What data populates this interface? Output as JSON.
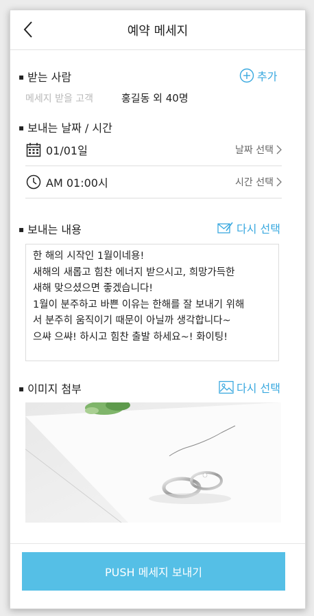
{
  "header": {
    "title": "예약 메세지"
  },
  "recipient": {
    "section_title": "받는 사람",
    "add_label": "추가",
    "field_label": "메세지 받을 고객",
    "value": "홍길동 외 40명"
  },
  "schedule": {
    "section_title": "보내는 날짜 / 시간",
    "date": {
      "value": "01/01일",
      "action": "날짜 선택"
    },
    "time": {
      "value": "AM 01:00시",
      "action": "시간 선택"
    }
  },
  "content": {
    "section_title": "보내는 내용",
    "reselect_label": "다시 선택",
    "message": "한 해의 시작인 1월이네용!\n새해의 새롭고 힘찬 에너지 받으시고, 희망가득한\n새해 맞으셨으면 좋겠습니다!\n1월이 분주하고 바쁜 이유는 한해를 잘 보내기 위해\n서 분주히 움직이기 때문이 아닐까 생각합니다~\n으쌰 으쌰! 하시고 힘찬 출발 하세요~! 화이팅!"
  },
  "attachment": {
    "section_title": "이미지 첨부",
    "reselect_label": "다시 선택",
    "image_icon": "wedding-rings-photo"
  },
  "footer": {
    "push_label": "PUSH 메세지 보내기"
  },
  "colors": {
    "accent": "#38a8df",
    "button": "#55bfe6"
  }
}
